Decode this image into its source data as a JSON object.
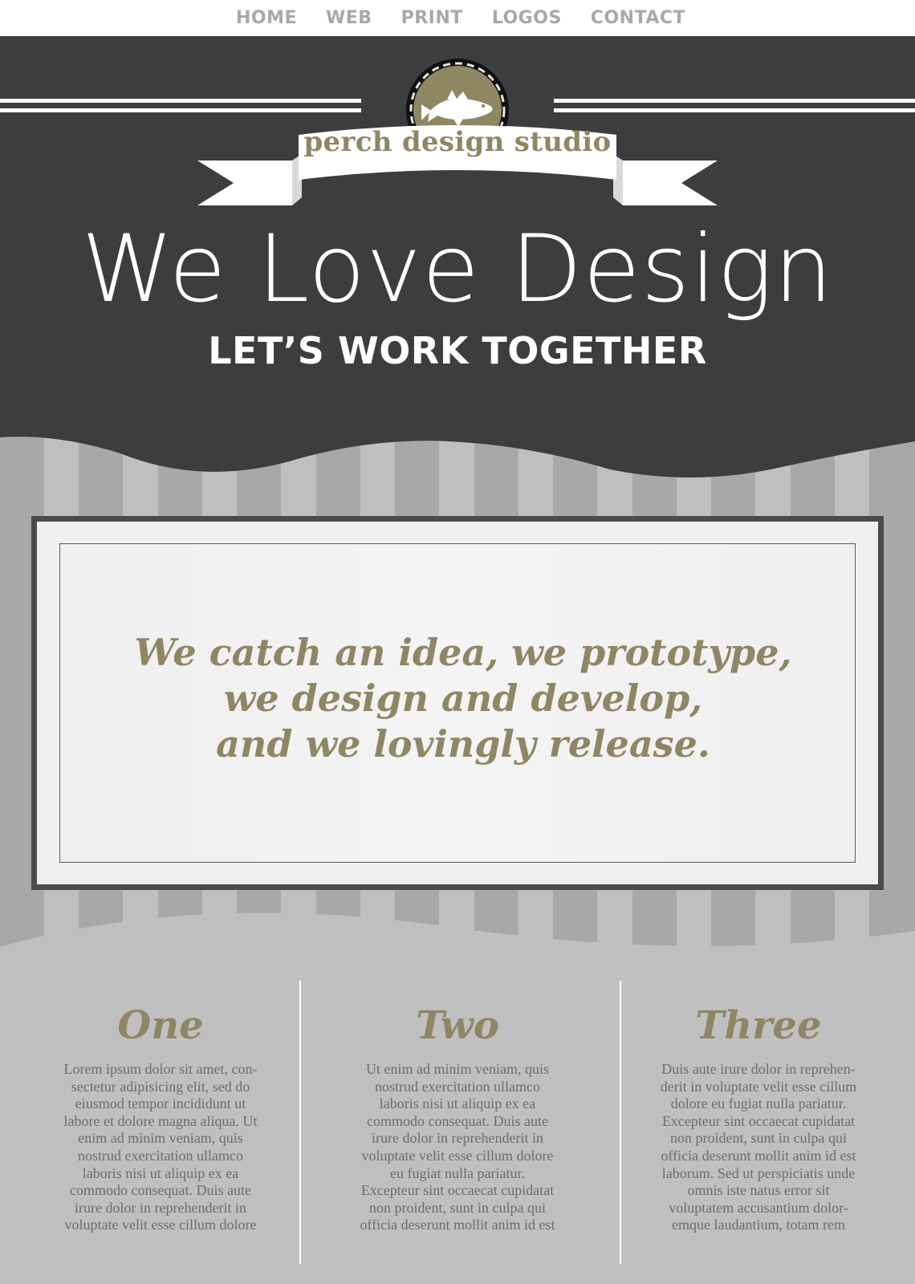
{
  "nav": {
    "items": [
      "HOME",
      "WEB",
      "PRINT",
      "LOGOS",
      "CONTACT"
    ]
  },
  "header": {
    "logo_icon": "fish-icon",
    "studio_name": "perch design studio",
    "title": "We Love Design",
    "subtitle": "LET’S WORK TOGETHER"
  },
  "quote": {
    "lines": [
      "We catch an idea, we prototype,",
      "we design and develop,",
      "and we lovingly release."
    ]
  },
  "columns": [
    {
      "title": "One",
      "lines": [
        "Lorem ipsum dolor sit amet, con-",
        "sectetur adipisicing elit, sed do",
        "eiusmod tempor incididunt ut",
        "labore et dolore magna aliqua. Ut",
        "enim ad minim veniam, quis",
        "nostrud exercitation ullamco",
        "laboris nisi ut aliquip ex ea",
        "commodo consequat. Duis aute",
        "irure dolor in reprehenderit in",
        "voluptate velit esse cillum dolore"
      ]
    },
    {
      "title": "Two",
      "lines": [
        "Ut enim ad minim veniam, quis",
        "nostrud exercitation ullamco",
        "laboris nisi ut aliquip ex ea",
        "commodo consequat. Duis aute",
        "irure dolor in reprehenderit in",
        "voluptate velit esse cillum dolore",
        "eu fugiat nulla pariatur.",
        "Excepteur sint occaecat cupidatat",
        "non proident, sunt in culpa qui",
        "officia deserunt mollit anim id est"
      ]
    },
    {
      "title": "Three",
      "lines": [
        "Duis aute irure dolor in reprehen-",
        "derit in voluptate velit esse cillum",
        "dolore eu fugiat nulla pariatur.",
        "Excepteur sint occaecat cupidatat",
        "non proident, sunt in culpa qui",
        "officia deserunt mollit anim id est",
        "laborum. Sed ut perspiciatis unde",
        "omnis iste natus error sit",
        "voluptatem accusantium dolor-",
        "emque laudantium, totam rem"
      ]
    }
  ],
  "colors": {
    "dark": "#3c3d3f",
    "accent": "#8f8664",
    "nav_text": "#a9a8a9",
    "stripe_dark": "#a9a8a9",
    "stripe_light": "#c0bfc0",
    "body_text": "#6e6d6e"
  }
}
